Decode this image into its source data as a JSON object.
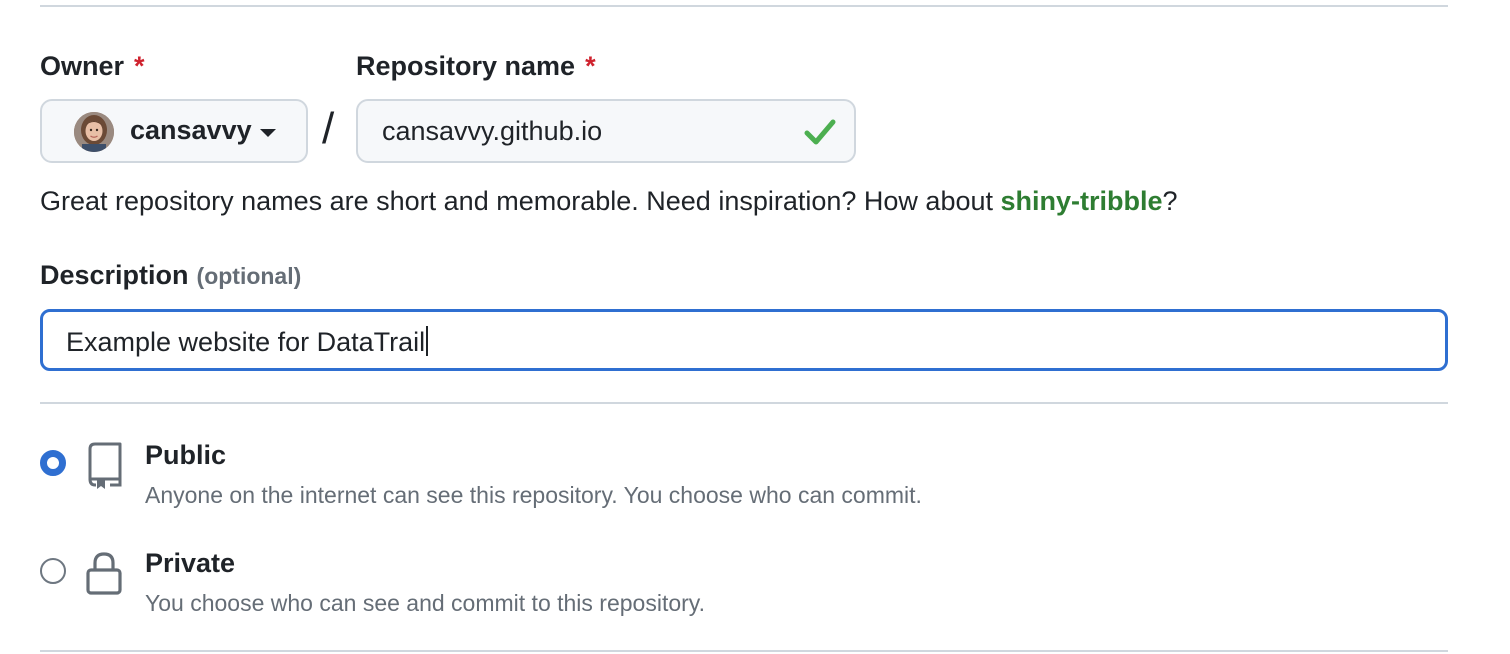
{
  "owner": {
    "label": "Owner",
    "required_mark": "*",
    "selected": "cansavvy",
    "avatar_icon": "user-avatar"
  },
  "separator": "/",
  "repository": {
    "label": "Repository name",
    "required_mark": "*",
    "value": "cansavvy.github.io",
    "valid_icon": "check-icon"
  },
  "helper": {
    "text_before": "Great repository names are short and memorable. Need inspiration? How about ",
    "suggestion": "shiny-tribble",
    "text_after": "?"
  },
  "description": {
    "label": "Description",
    "optional_note": "(optional)",
    "value": "Example website for DataTrail"
  },
  "visibility": {
    "options": [
      {
        "title": "Public",
        "description": "Anyone on the internet can see this repository. You choose who can commit.",
        "icon": "repo-icon",
        "selected": true
      },
      {
        "title": "Private",
        "description": "You choose who can see and commit to this repository.",
        "icon": "lock-icon",
        "selected": false
      }
    ]
  },
  "colors": {
    "accent": "#2f6fd1",
    "required": "#cf222e",
    "success": "#2e7d32",
    "muted": "#656d76"
  }
}
